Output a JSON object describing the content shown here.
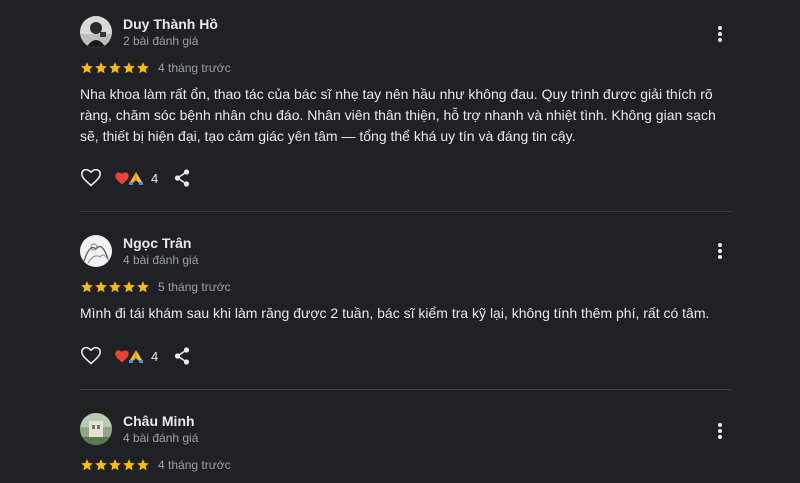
{
  "colors": {
    "background": "#202124",
    "text_primary": "#e8eaed",
    "text_secondary": "#9aa0a6",
    "star": "#fbbc04",
    "divider": "#3c4043",
    "heart": "#ea4335"
  },
  "reviews": [
    {
      "author": "Duy Thành Hồ",
      "review_count": "2 bài đánh giá",
      "rating": 5,
      "date": "4 tháng trước",
      "text": "Nha khoa làm rất ổn, thao tác của bác sĩ nhẹ tay nên hầu như không đau. Quy trình được giải thích rõ ràng, chăm sóc bệnh nhân chu đáo. Nhân viên thân thiện, hỗ trợ nhanh và nhiệt tình. Không gian sạch sẽ, thiết bị hiện đại, tạo cảm giác yên tâm — tổng thể khá uy tín và đáng tin cậy.",
      "reactions": "4",
      "avatar_icon": "profile-photo-icon"
    },
    {
      "author": "Ngọc Trân",
      "review_count": "4 bài đánh giá",
      "rating": 5,
      "date": "5 tháng trước",
      "text": "Mình đi tái khám sau khi làm răng được 2 tuần, bác sĩ kiểm tra kỹ lại, không tính thêm phí, rất có tâm.",
      "reactions": "4",
      "avatar_icon": "profile-photo-icon"
    },
    {
      "author": "Châu Minh",
      "review_count": "4 bài đánh giá",
      "rating": 5,
      "date": "4 tháng trước",
      "avatar_icon": "profile-photo-icon"
    }
  ],
  "icons": {
    "more": "more-vert-icon",
    "like": "heart-outline-icon",
    "reaction_heart": "red-heart-emoji-icon",
    "reaction_pray": "folded-hands-emoji-icon",
    "share": "share-icon",
    "star": "star-icon"
  }
}
